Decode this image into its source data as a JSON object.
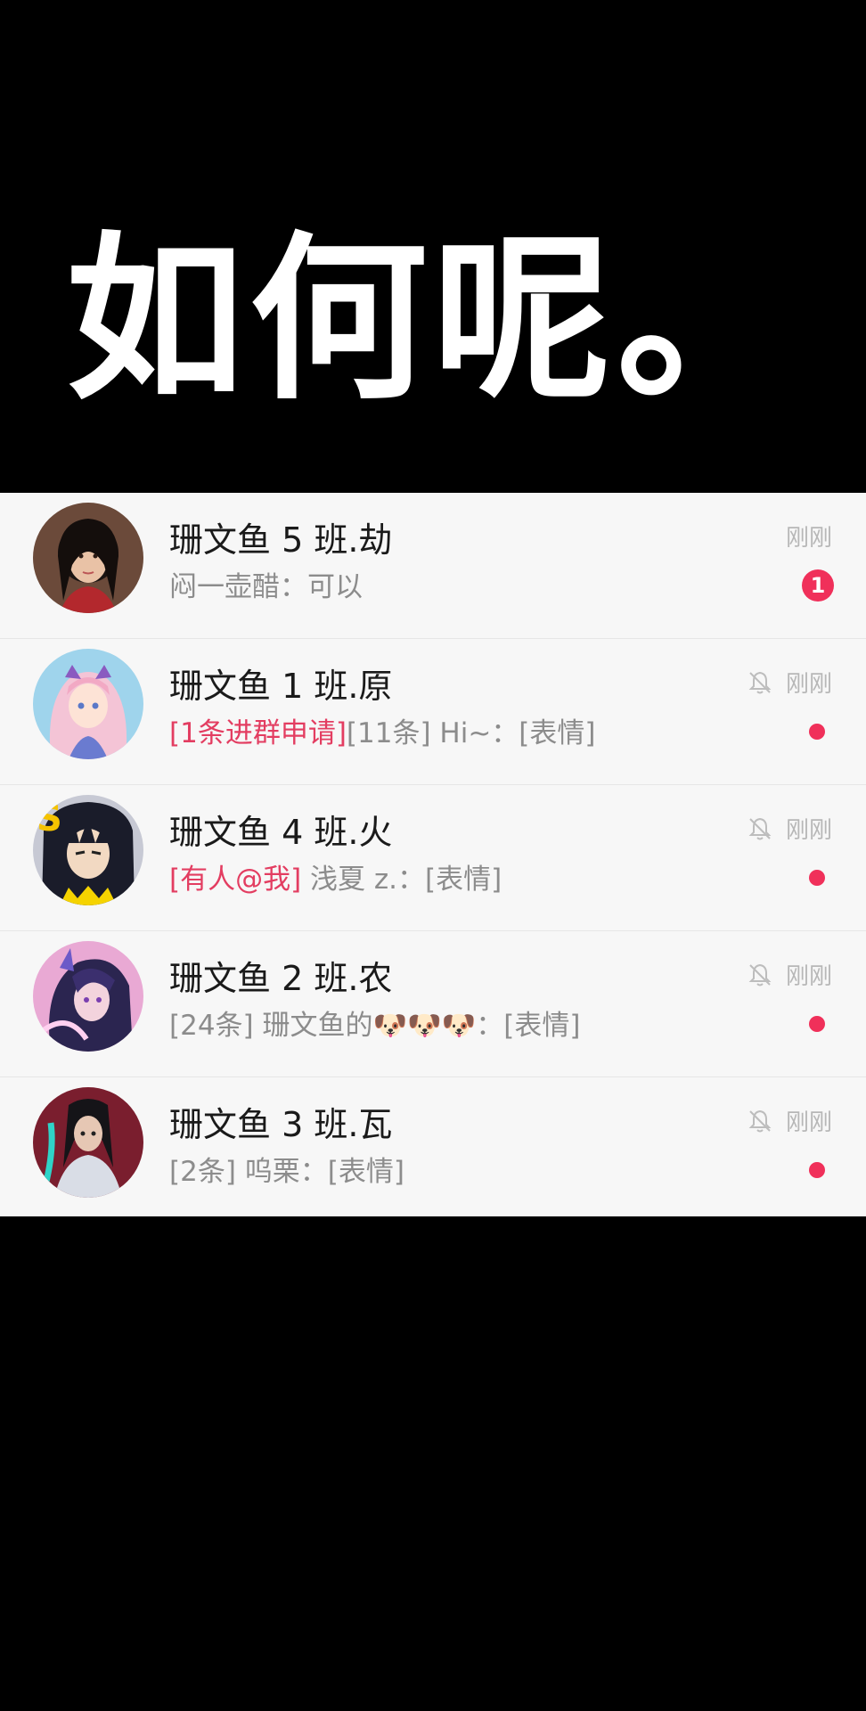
{
  "headline": "如何呢。",
  "colors": {
    "accent": "#f0305a",
    "tag": "#e33d61",
    "panel": "#f7f7f7"
  },
  "chats": [
    {
      "title": "珊文鱼 5 班.劫",
      "preview_tag": "",
      "preview": "闷一壶醋：可以",
      "time": "刚刚",
      "muted": false,
      "unread": "1",
      "avatar_icon": "avatar-dark-hair-woman"
    },
    {
      "title": "珊文鱼 1 班.原",
      "preview_tag": "[1条进群申请]",
      "preview": "[11条] Hi~：[表情]",
      "time": "刚刚",
      "muted": true,
      "unread": "",
      "avatar_icon": "avatar-pink-hair-girl"
    },
    {
      "title": "珊文鱼 4 班.火",
      "preview_tag": "[有人@我]",
      "preview": " 浅夏 z.：[表情]",
      "time": "刚刚",
      "muted": true,
      "unread": "",
      "avatar_icon": "avatar-ninja-boy"
    },
    {
      "title": "珊文鱼 2 班.农",
      "preview_tag": "",
      "preview": "[24条] 珊文鱼的🐶🐶🐶：[表情]",
      "time": "刚刚",
      "muted": true,
      "unread": "",
      "avatar_icon": "avatar-purple-fantasy-girl"
    },
    {
      "title": "珊文鱼 3 班.瓦",
      "preview_tag": "",
      "preview": "[2条] 呜栗：[表情]",
      "time": "刚刚",
      "muted": true,
      "unread": "",
      "avatar_icon": "avatar-agent-woman"
    }
  ]
}
